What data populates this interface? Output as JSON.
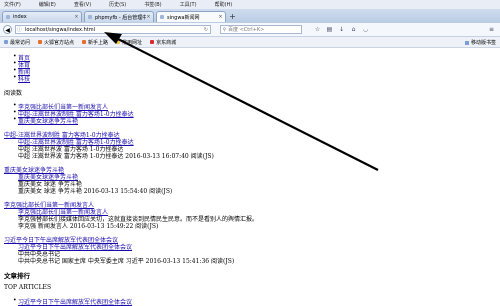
{
  "menu": [
    "文件(F)",
    "编辑(E)",
    "查看(V)",
    "历史(S)",
    "书签(B)",
    "工具(T)",
    "帮助(H)"
  ],
  "tabs": [
    {
      "label": "index",
      "active": false
    },
    {
      "label": "phpmyfb - 后台管理中心",
      "active": false
    },
    {
      "label": "singwa新闻网",
      "active": true
    }
  ],
  "address": {
    "url": "localhost/singwa/index.html"
  },
  "search": {
    "placeholder": "百度 <Ctrl+K>"
  },
  "bookmarks": {
    "items": [
      "最常访问",
      "火狐官方站点",
      "新手上路",
      "常用网址",
      "京东商城"
    ],
    "right": "移动版书签"
  },
  "nav": [
    "首页",
    "体育",
    "新闻",
    "科技"
  ],
  "section_title": "阅读数",
  "reading_list": [
    "李克强比部长们当第一新闻发言人",
    "中超-汪嵩世界波制胜 富力客场1-0力挫泰达",
    "重庆美女球迷争芳斗艳"
  ],
  "articles": [
    {
      "title": "中超-汪嵩世界波制胜 富力客场1-0力挫泰达",
      "sub1": "中超-汪嵩世界波制胜 富力客场1-0力挫泰达",
      "sub2": "中超 汪嵩世界波 富力客场 1-0力挫泰达",
      "meta": "中超 汪嵩世界波 富力客场 1-0力挫泰达 2016-03-13 16:07:40 阅读(JS)"
    },
    {
      "title": "重庆美女球迷争芳斗艳",
      "sub1": "重庆美女球迷争芳斗艳",
      "sub2": "重庆美女 球迷 争芳斗艳",
      "meta": "重庆美女 球迷 争芳斗艳 2016-03-13 15:54:40 阅读(JS)"
    },
    {
      "title": "李克强比部长们当第一新闻发言人",
      "sub1": "李克强比部长们当第一新闻发言人",
      "sub2": "李克强替部长们接媒体回应关切，这就直接谈到民情民生民意。而不是看别人的舆情汇报。",
      "meta": "李克强 新闻发言人 2016-03-13 15:49:22 阅读(JS)"
    },
    {
      "title": "习近平今日下午出席解放军代表团全体会议",
      "sub1": "习近平今日下午出席解放军代表团全体会议",
      "sub2": "中共中央总书记",
      "meta": "中共中央总书记 国家主席 中央军委主席 习近平 2016-03-13 15:41:36 阅读(JS)"
    }
  ],
  "ranking": {
    "title": "文章排行",
    "subtitle": "TOP ARTICLES",
    "first": "习近平今日下午出席解放军代表团全体会议"
  }
}
